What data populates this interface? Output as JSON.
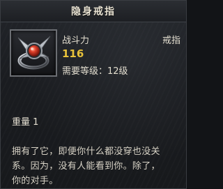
{
  "item": {
    "name": "隐身戒指",
    "power_label": "战斗力",
    "power_value": "116",
    "type": "戒指",
    "requirement": "需要等级：12级",
    "weight": "重量 1",
    "description_lines": [
      "拥有了它，即便你什么都没穿也没关",
      "系。因为，没有人能看到你。除了，",
      "你的对手。"
    ]
  },
  "icon": "ring-red-gem-icon",
  "colors": {
    "power_value": "#e8c23a",
    "text": "#e2ddcf",
    "background": "#1a1c20"
  }
}
